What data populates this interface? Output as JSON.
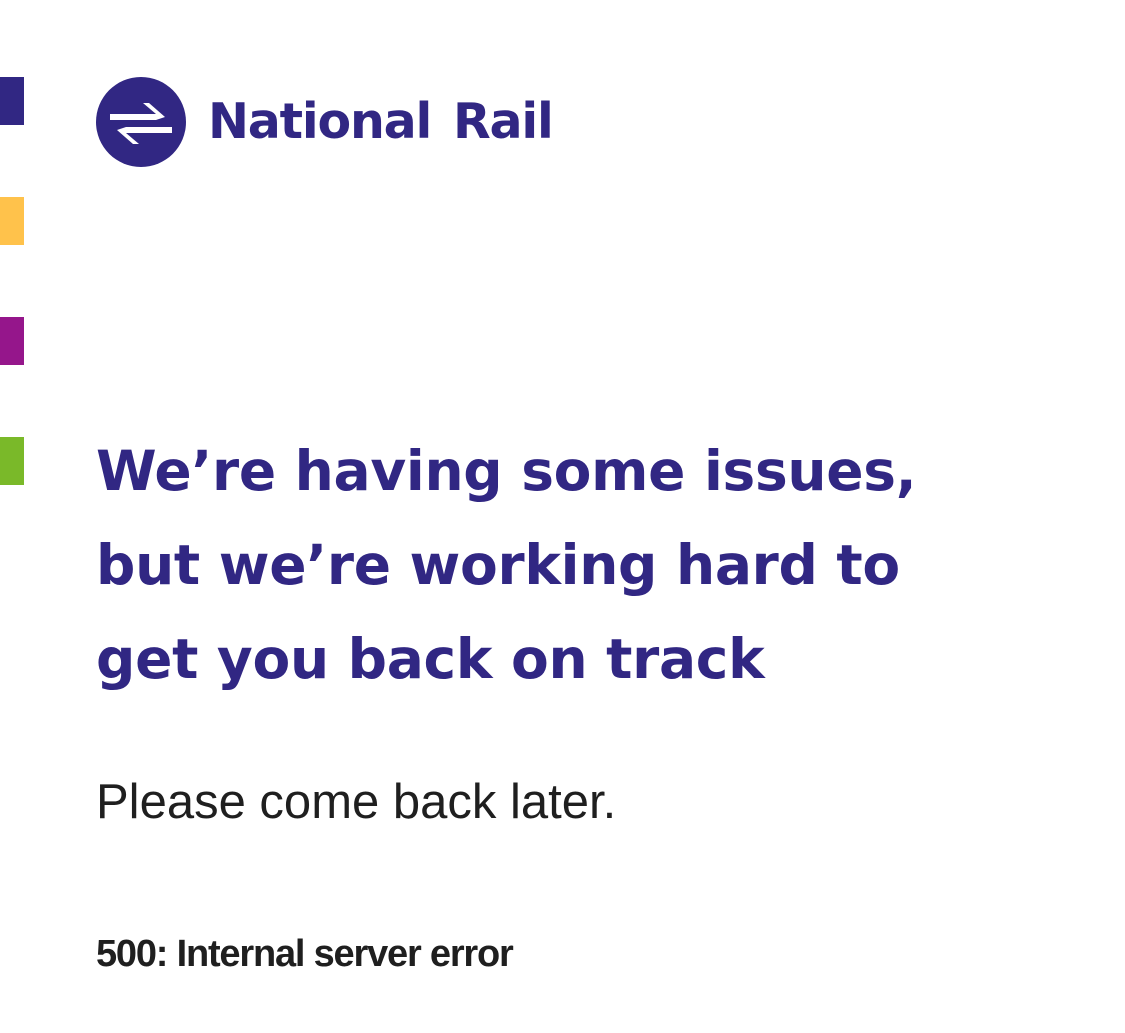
{
  "brand": {
    "name": "National Rail",
    "logo_icon": "national-rail-double-arrow-icon",
    "primary_color": "#312783",
    "text_dark": "#1f1f1f"
  },
  "side_stripes": [
    {
      "color": "#312783"
    },
    {
      "color": "#FFC24B"
    },
    {
      "color": "#95168B"
    },
    {
      "color": "#7AB929"
    }
  ],
  "error_page": {
    "headline_lines": [
      "We’re having some issues,",
      "but we’re working hard to",
      "get you back on track"
    ],
    "message": "Please come back later.",
    "error_code_text": "500: Internal server error"
  }
}
